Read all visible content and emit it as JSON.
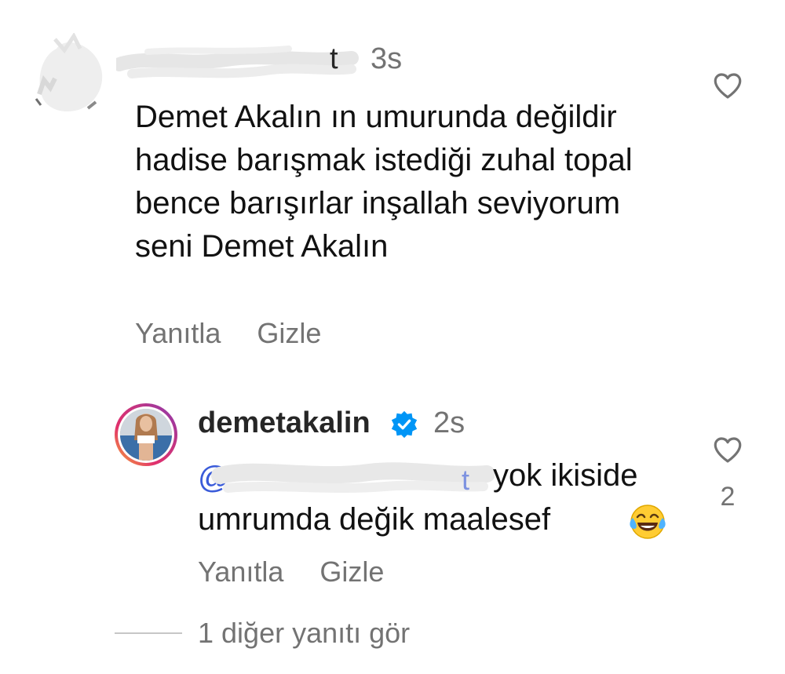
{
  "comment": {
    "username_visible": "t",
    "time": "3s",
    "text": "Demet Akalın ın umurunda değildir hadise barışmak istediği zuhal topal bence barışırlar inşallah seviyorum seni Demet Akalın",
    "reply_label": "Yanıtla",
    "hide_label": "Gizle"
  },
  "reply": {
    "username": "demetakalin",
    "time": "2s",
    "mention_visible": "@",
    "text_line1": "yok ikiside",
    "text_line2": "umrumda değik maalesef",
    "emoji_icon": "face-with-tears-of-joy-icon",
    "likes": "2",
    "reply_label": "Yanıtla",
    "hide_label": "Gizle"
  },
  "more_replies": "1 diğer yanıtı gör",
  "colors": {
    "text": "#111111",
    "secondary": "#737373",
    "mention": "#3a5bd9",
    "verified": "#0095f6",
    "scribble": "#e6e6e6"
  }
}
